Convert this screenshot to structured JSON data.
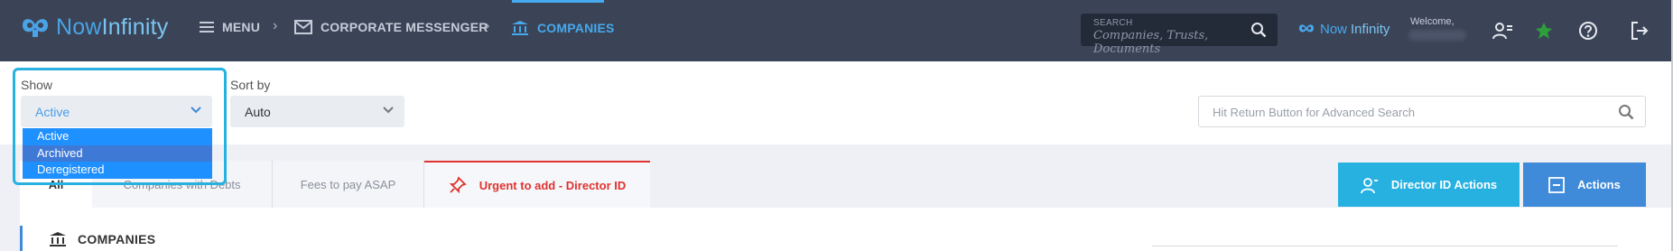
{
  "header": {
    "logo_text_a": "Now",
    "logo_text_b": "Infinity",
    "menu_label": "MENU",
    "breadcrumb_1": "CORPORATE MESSENGER",
    "breadcrumb_2": "COMPANIES",
    "search_label": "SEARCH",
    "search_placeholder": "Companies,  Trusts,  Documents",
    "brand_small_a": "Now",
    "brand_small_b": "Infinity",
    "welcome": "Welcome,"
  },
  "filters": {
    "show_label": "Show",
    "show_value": "Active",
    "show_options": [
      "Active",
      "Archived",
      "Deregistered"
    ],
    "sort_label": "Sort by",
    "sort_value": "Auto",
    "advanced_search_placeholder": "Hit Return Button for Advanced Search"
  },
  "tabs": {
    "all": "All",
    "debts": "Companies with Debts",
    "fees": "Fees to pay ASAP",
    "urgent": "Urgent to add - Director ID"
  },
  "buttons": {
    "director": "Director ID Actions",
    "actions": "Actions"
  },
  "section": {
    "title": "COMPANIES"
  },
  "colors": {
    "topbar": "#3b4457",
    "accent_blue": "#46a8ee",
    "highlight_cyan": "#27b1e1",
    "urgent_red": "#e0322f",
    "dropdown_blue": "#1e90ff"
  },
  "icons": [
    "menu-icon",
    "envelope-icon",
    "bank-icon",
    "search-icon",
    "contact-card-icon",
    "leaf-icon",
    "help-icon",
    "logout-icon",
    "chevron-down-icon",
    "pin-icon",
    "director-icon",
    "actions-icon"
  ]
}
